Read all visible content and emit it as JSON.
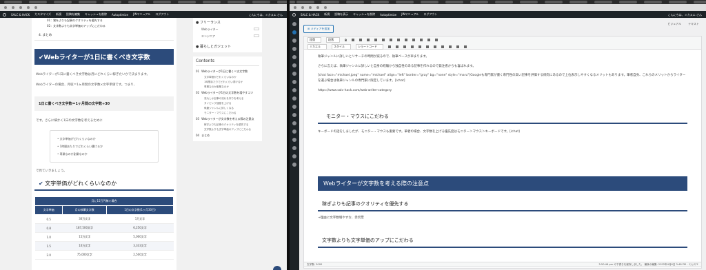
{
  "left_window": {
    "site_name": "SALC & HACK",
    "admin_items": [
      "カスタマイズ",
      "新規",
      "投稿を編集",
      "キャッシュを削除",
      "Autoptimize",
      "JINマニュアル",
      "ログアウト"
    ],
    "greeting": "こんにちは、ミカスエ さん",
    "toc_subitems": [
      "01：質をよりも記事のクオリティを優先する",
      "02：文字数よりも文字単価のアップにこだわる"
    ],
    "toc_item_4": "4. まとめ",
    "heading_main": "Webライターが1日に書くべき文字数",
    "para1": "Webライターが1日に書くべき文字数は月にどれくらい稼ぎたいかで決まります。",
    "para2": "Webライターの場合、月収＝1ヶ月間の文字数×文字単価です。つまり、",
    "grey_box": "1日に書くべき文字数＝1ヶ月間の文字数÷30",
    "para3": "です。さらに細かく1日の文字数を考えるために",
    "list_items": [
      "文字単価がどれくらいなのか",
      "1時間あたりでどれくらい書けるか",
      "専業なのか副業なのか"
    ],
    "para4": "で見ていきましょう。",
    "subheading": "文字単価がどれくらいなのか",
    "table": {
      "caption": "月に15万円稼ぐ場合",
      "headers": [
        "文字単価",
        "月の執筆文字数",
        "1日の文字数(1ヶ月30日)"
      ],
      "rows": [
        [
          "0.5",
          "30万文字",
          "1万文字"
        ],
        [
          "0.8",
          "187,500文字",
          "6,250文字"
        ],
        [
          "1.0",
          "15万文字",
          "5,000文字"
        ],
        [
          "1.5",
          "10万文字",
          "3,333文字"
        ],
        [
          "2.0",
          "75,000文字",
          "2,500文字"
        ]
      ]
    },
    "sidebar": {
      "freelance_title": "フリーランス",
      "freelance_items": [
        "Webライター",
        "エンジニア"
      ],
      "gadget": "暮らしとガジェット",
      "contents_title": "Contents",
      "contents": [
        {
          "num": "01",
          "title": "Webライターが1日に書くべき文字数",
          "subs": [
            "文字単価がどれくらいなのか",
            "1時間あたりでどれくらい書けるか",
            "専業なのか副業なのか"
          ]
        },
        {
          "num": "02",
          "title": "Webライターが1日の文字数を増やすコツ",
          "subs": [
            "流れしか記事の流れを作りを考える",
            "タイピング速度を上げる",
            "執筆ジャンルに詳しくなる",
            "モニター・マウスにこだわる"
          ]
        },
        {
          "num": "03",
          "title": "Webライターが文字数を考える際の注意点",
          "subs": [
            "稼ぎよりも記事のクオリティを優先する",
            "文字数よりも文字単価のアップにこだわる"
          ]
        },
        {
          "num": "04",
          "title": "まとめ",
          "subs": []
        }
      ]
    }
  },
  "right_window": {
    "site_name": "SALC & HACK",
    "admin_items": [
      "新規",
      "投稿を表示",
      "キャッシュを削除",
      "Autoptimize",
      "JINマニュアル",
      "ログアウト"
    ],
    "greeting": "こんにちは、ミカスエ さん",
    "media_button": "メディアを追加",
    "mode_tabs": [
      "ビジュアル",
      "テキスト"
    ],
    "toolbar_row1": [
      "段落",
      "段落"
    ],
    "toolbar_row2": [
      "ミカエル",
      "スタイル",
      "ショートコード"
    ],
    "content": {
      "p1": "執筆ジャンルに詳しいとリサーチの時間が減るので、執筆ペースが早まります。",
      "p2": "さらに言えば、執筆ジャンルに詳しいと自身の経験から独自性のある記事を作れるので発注者からも喜ばれます。",
      "p3": "[chat face=\"michael.jpeg\" name=\"michael\" align=\"left\" border=\"gray\" bg=\"none\" style=\"maru\"]Googleも専門家が書く専門性の高い記事を評価する傾向にあるので上位表示しやすくなるメリットもあります。筆者自身、これらのメリットからライターを選ぶ場合は執筆ジャンルの専門家に限定しています。[/chat]",
      "link": "https://www.salc-hack.com/web-writer-category",
      "h3_monitor": "モニター・マウスにこだわる",
      "p4": "キーボードの話をしましたが、モニター・マウスも重要です。筆者の場合、文字数を上げる優先度はモニター＞マウス＞キーボードです。[/chat]",
      "h2_caution": "Webライターが文字数を考える際の注意点",
      "h3_quality": "稼ぎよりも記事のクオリティを優先する",
      "p5": "→理由に文字数増やすな、赤伝票",
      "h3_price": "文字数よりも文字単価のアップにこだわる"
    },
    "status_left": "文字数: 2000",
    "status_right": "3:50:46 pm の下書きを保存しました。 最後の編集: 2022年4月6日 3:48 PM - ミカスエ"
  }
}
